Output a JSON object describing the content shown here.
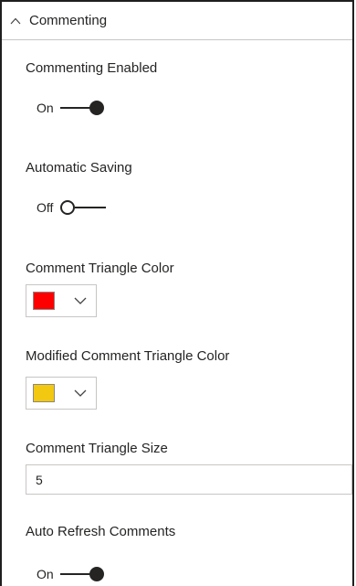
{
  "section": {
    "title": "Commenting",
    "expanded": true,
    "icon": "chevron-up-icon"
  },
  "commenting_enabled": {
    "label": "Commenting Enabled",
    "state_label": "On",
    "value": true
  },
  "automatic_saving": {
    "label": "Automatic Saving",
    "state_label": "Off",
    "value": false
  },
  "comment_triangle_color": {
    "label": "Comment Triangle Color",
    "color": "#ff0000",
    "icon": "chevron-down-icon"
  },
  "modified_comment_triangle_color": {
    "label": "Modified Comment Triangle Color",
    "color": "#f2c811",
    "icon": "chevron-down-icon"
  },
  "comment_triangle_size": {
    "label": "Comment Triangle Size",
    "value": "5"
  },
  "auto_refresh_comments": {
    "label": "Auto Refresh Comments",
    "state_label": "On",
    "value": true
  }
}
